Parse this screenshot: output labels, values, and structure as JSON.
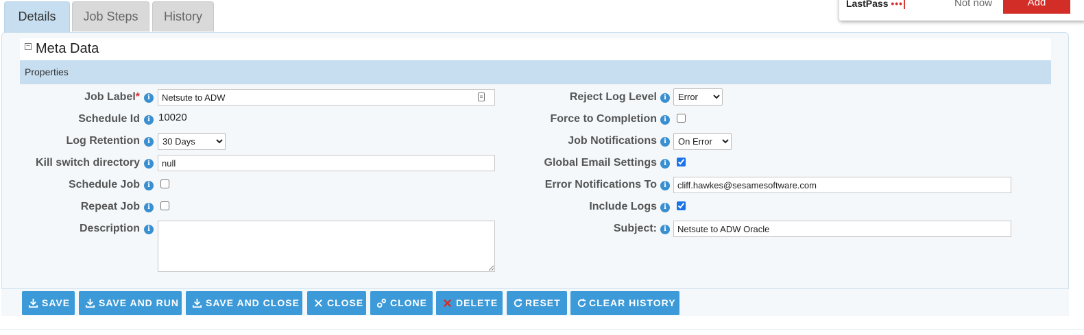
{
  "tabs": [
    {
      "label": "Details",
      "active": true
    },
    {
      "label": "Job Steps",
      "active": false
    },
    {
      "label": "History",
      "active": false
    }
  ],
  "lastpass": {
    "logo_text": "LastPass",
    "logo_dots": "•••|",
    "not_now": "Not now",
    "add": "Add"
  },
  "section": {
    "title": "Meta Data",
    "collapse_symbol": "−",
    "subheader": "Properties"
  },
  "left_fields": {
    "job_label": {
      "label": "Job Label",
      "required_mark": "*",
      "value": "Netsute to ADW"
    },
    "schedule_id": {
      "label": "Schedule Id",
      "value": "10020"
    },
    "log_retention": {
      "label": "Log Retention",
      "value": "30 Days"
    },
    "kill_switch": {
      "label": "Kill switch directory",
      "value": "null"
    },
    "schedule_job": {
      "label": "Schedule Job",
      "checked": false
    },
    "repeat_job": {
      "label": "Repeat Job",
      "checked": false
    },
    "description": {
      "label": "Description",
      "value": ""
    }
  },
  "right_fields": {
    "reject_log_level": {
      "label": "Reject Log Level",
      "value": "Error"
    },
    "force_completion": {
      "label": "Force to Completion",
      "checked": false
    },
    "job_notifications": {
      "label": "Job Notifications",
      "value": "On Error"
    },
    "global_email": {
      "label": "Global Email Settings",
      "checked": true
    },
    "error_notifications": {
      "label": "Error Notifications To",
      "value": "cliff.hawkes@sesamesoftware.com"
    },
    "include_logs": {
      "label": "Include Logs",
      "checked": true
    },
    "subject": {
      "label": "Subject:",
      "value": "Netsute to ADW Oracle"
    }
  },
  "info_glyph": "i",
  "buttons": {
    "save": "SAVE",
    "save_and_run": "SAVE AND RUN",
    "save_and_close": "SAVE AND CLOSE",
    "close": "CLOSE",
    "clone": "CLONE",
    "delete": "DELETE",
    "reset": "RESET",
    "clear_history": "CLEAR HISTORY"
  },
  "colors": {
    "accent": "#3d9ad8",
    "header_band": "#c6def0",
    "required": "#d32d27",
    "lastpass_red": "#d32d27"
  }
}
